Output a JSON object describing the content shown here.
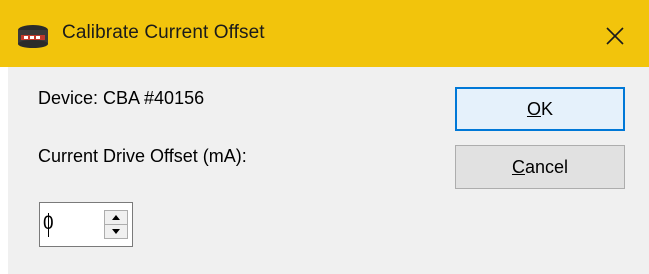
{
  "window": {
    "title": "Calibrate Current Offset",
    "titlebar_color": "#f2c40c",
    "app_icon": "device-box-icon",
    "close_icon": "close-x-icon"
  },
  "form": {
    "device_label": "Device: CBA #40156",
    "offset_label": "Current Drive Offset (mA):",
    "offset_value": "0",
    "spin_up_icon": "chevron-up-icon",
    "spin_down_icon": "chevron-down-icon"
  },
  "buttons": {
    "ok": {
      "mnemonic": "O",
      "rest": "K"
    },
    "cancel": {
      "mnemonic": "C",
      "rest": "ancel"
    },
    "accent": "#0078d7"
  }
}
